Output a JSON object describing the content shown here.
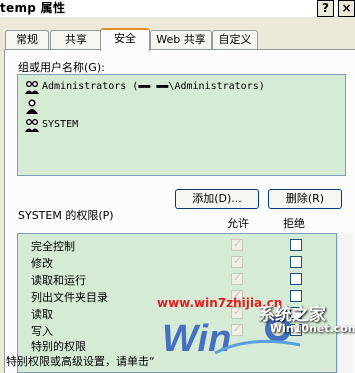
{
  "window": {
    "title": "temp 属性",
    "help_glyph": "?",
    "close_glyph": "×"
  },
  "tabs": [
    {
      "label": "常规",
      "active": false
    },
    {
      "label": "共享",
      "active": false
    },
    {
      "label": "安全",
      "active": true
    },
    {
      "label": "Web 共享",
      "active": false
    },
    {
      "label": "自定义",
      "active": false
    }
  ],
  "security": {
    "users_label": "组或用户名称(G):",
    "users": [
      {
        "name": "Administrators (▬▬ ▬▬\\Administrators)",
        "icon": "user-group-icon"
      },
      {
        "name": "",
        "icon": "user-icon"
      },
      {
        "name": "SYSTEM",
        "icon": "user-group-icon",
        "selected": true
      }
    ],
    "add_button": "添加(D)...",
    "remove_button": "删除(R)",
    "perm_label": "SYSTEM 的权限(P)",
    "allow_header": "允许",
    "deny_header": "拒绝",
    "permissions": [
      {
        "name": "完全控制",
        "allow": true,
        "deny": false
      },
      {
        "name": "修改",
        "allow": true,
        "deny": false
      },
      {
        "name": "读取和运行",
        "allow": true,
        "deny": false
      },
      {
        "name": "列出文件夹目录",
        "allow": true,
        "deny": false
      },
      {
        "name": "读取",
        "allow": true,
        "deny": false
      },
      {
        "name": "写入",
        "allow": true,
        "deny": false
      },
      {
        "name": "特别的权限",
        "allow": false,
        "deny": false
      }
    ],
    "advanced_text": "特别权限或高级设置，请单击“"
  },
  "watermark": {
    "url": "www.win7zhijia.cn",
    "brand": "系统之家",
    "domain": "Win10net.com",
    "logo_text": "Win"
  },
  "colors": {
    "list_bg": "#d6ebd6",
    "accent": "#e68b2c",
    "watermark_red": "#e02020",
    "logo_blue": "#2a5ab8"
  }
}
